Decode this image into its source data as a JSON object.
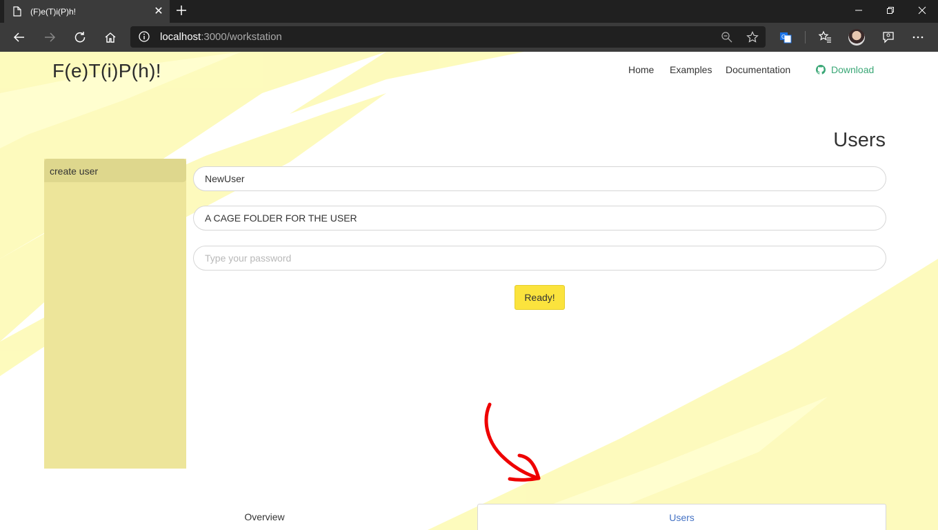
{
  "browser": {
    "tab_title": "(F)e(T)i(P)h!",
    "url_host": "localhost",
    "url_rest": ":3000/workstation"
  },
  "header": {
    "brand": "F(e)T(i)P(h)!",
    "nav": [
      "Home",
      "Examples",
      "Documentation"
    ],
    "download_label": "Download"
  },
  "main": {
    "title": "Users",
    "sidebar_item": "create user",
    "username_value": "NewUser",
    "folder_value": "A CAGE FOLDER FOR THE USER",
    "password_placeholder": "Type your password",
    "submit_label": "Ready!"
  },
  "bottom_tabs": {
    "overview": "Overview",
    "users": "Users"
  },
  "colors": {
    "accent_yellow": "#fbe33d",
    "sidebar": "#ede59a",
    "download_green": "#3aa776",
    "annotation_red": "#ee0000"
  }
}
